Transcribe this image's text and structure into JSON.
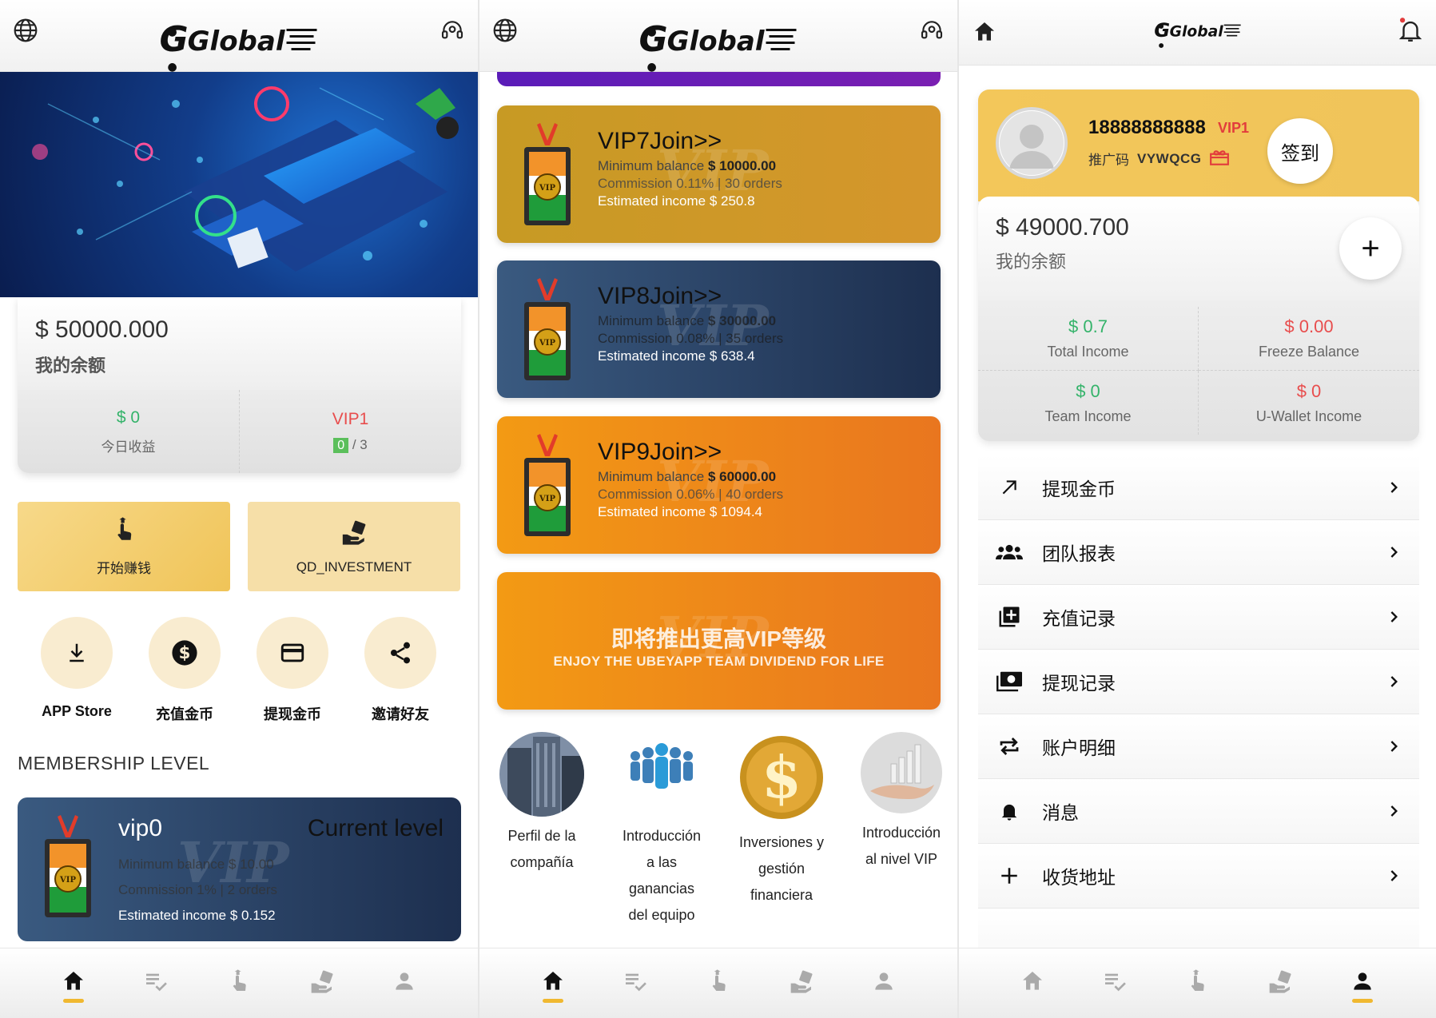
{
  "header": {
    "logo_text": "Global"
  },
  "home": {
    "balance": {
      "amount": "$ 50000.000",
      "label": "我的余额"
    },
    "today_income": {
      "value": "$ 0",
      "label": "今日收益"
    },
    "vip_status": {
      "level": "VIP1",
      "done": "0",
      "total": "/ 3"
    },
    "buttons": {
      "earn": "开始赚钱",
      "invest": "QD_INVESTMENT"
    },
    "shortcuts": [
      {
        "label": "APP Store",
        "icon": "download-icon"
      },
      {
        "label": "充值金币",
        "icon": "dollar-icon"
      },
      {
        "label": "提现金币",
        "icon": "card-icon"
      },
      {
        "label": "邀请好友",
        "icon": "share-icon"
      }
    ],
    "membership_title": "MEMBERSHIP LEVEL",
    "vip0": {
      "title": "vip0",
      "current": "Current level",
      "line1": "Minimum balance $ 10.00",
      "line2": "Commission 1% | 2 orders",
      "line3": "Estimated income $ 0.152"
    }
  },
  "vip_list": [
    {
      "title": "VIP7Join>>",
      "min_label": "Minimum balance ",
      "min_value": "$ 10000.00",
      "commission": "Commission 0.11% | 30 orders",
      "income": "Estimated income $ 250.8",
      "theme": "gold"
    },
    {
      "title": "VIP8Join>>",
      "min_label": "Minimum balance ",
      "min_value": "$ 30000.00",
      "commission": "Commission 0.08% | 35 orders",
      "income": "Estimated income $ 638.4",
      "theme": "navy"
    },
    {
      "title": "VIP9Join>>",
      "min_label": "Minimum balance ",
      "min_value": "$ 60000.00",
      "commission": "Commission 0.06% | 40 orders",
      "income": "Estimated income $ 1094.4",
      "theme": "orange"
    }
  ],
  "promo": {
    "headline": "即将推出更高VIP等级",
    "subline": "ENJOY THE UBEYAPP TEAM DIVIDEND FOR LIFE"
  },
  "info_items": [
    {
      "l1": "Perfil de la",
      "l2": "compañía",
      "l3": "",
      "l4": ""
    },
    {
      "l1": "Introducción",
      "l2": "a las",
      "l3": "ganancias",
      "l4": "del equipo"
    },
    {
      "l1": "Inversiones y",
      "l2": "gestión",
      "l3": "financiera",
      "l4": ""
    },
    {
      "l1": "Introducción",
      "l2": "al nivel VIP",
      "l3": "",
      "l4": ""
    }
  ],
  "profile": {
    "phone": "18888888888",
    "vip": "VIP1",
    "promo_label": "推广码",
    "promo_code": "VYWQCG",
    "checkin": "签到",
    "balance": "$ 49000.700",
    "balance_label": "我的余额",
    "plus": "+",
    "income": [
      {
        "value": "$ 0.7",
        "label": "Total Income",
        "color": "#34b36a"
      },
      {
        "value": "$ 0.00",
        "label": "Freeze Balance",
        "color": "#e84d4d"
      },
      {
        "value": "$ 0",
        "label": "Team Income",
        "color": "#34b36a"
      },
      {
        "value": "$ 0",
        "label": "U-Wallet Income",
        "color": "#e84d4d"
      }
    ],
    "menu": [
      {
        "label": "提现金币",
        "icon": "arrow-up-right-icon"
      },
      {
        "label": "团队报表",
        "icon": "group-icon"
      },
      {
        "label": "充值记录",
        "icon": "add-box-icon"
      },
      {
        "label": "提现记录",
        "icon": "money-icon"
      },
      {
        "label": "账户明细",
        "icon": "repeat-icon"
      },
      {
        "label": "消息",
        "icon": "bell-icon"
      },
      {
        "label": "收货地址",
        "icon": "plus-icon"
      }
    ]
  },
  "colors": {
    "accent": "#f0b830",
    "gold_card": "#c79a24",
    "navy_card": "#2a4468",
    "orange_card": "#f0861a",
    "green": "#34b36a",
    "red": "#e84d4d"
  }
}
